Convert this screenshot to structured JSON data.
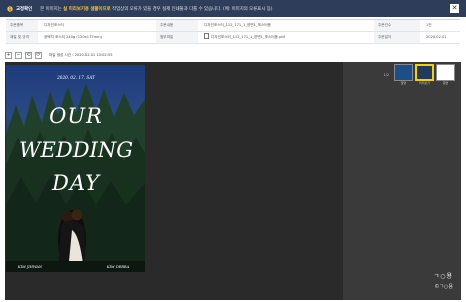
{
  "header": {
    "title": "교정확인",
    "message_prefix": "본 이미지는",
    "message_highlight": "실 미리보기용 샘플이므로",
    "message_suffix": "작업상의 오류가 있을 경우 실제 인쇄물과 다를 수 있습니다. (예: 이미지의 오류표시 등)",
    "close_label": "✕"
  },
  "info": {
    "rows": [
      {
        "label1": "주문품목",
        "value1": "디자인포스터",
        "label2": "주문내용",
        "value2": "디자인포스터_112_171_1_양면1_포스터용",
        "label3": "주문건수",
        "value3": "1건"
      },
      {
        "label1": "재질 및 규격",
        "value1": "광택지 포스터 240g (120x177mm)",
        "label2": "첨부파일",
        "value2": "디자인포스터_112_171_1_양면1_포스터용.pdf",
        "label3": "주문일자",
        "value3": "2020.02.01"
      }
    ]
  },
  "toolbar": {
    "buttons": [
      "+",
      "−",
      "⟲",
      "⟳"
    ],
    "note": "파일 생성 시간 : 2020.02.01 13:02:55"
  },
  "poster": {
    "date": "2020. 02. 17. SAT",
    "line1": "OUR",
    "line2": "WEDDING",
    "line3": "DAY",
    "groom": "KIM JIHWAN",
    "bride": "KIM DEBRA"
  },
  "thumbnails": {
    "index": "1/2",
    "items": [
      "앞면",
      "미리보기",
      "뒷면"
    ]
  },
  "branding": {
    "logo": "ㄱ○용",
    "sub": "©ㄱ○용"
  },
  "colors": {
    "topbar": "#2e3e5a",
    "highlight": "#f6c341",
    "thumb_selected": "#f2d200"
  }
}
